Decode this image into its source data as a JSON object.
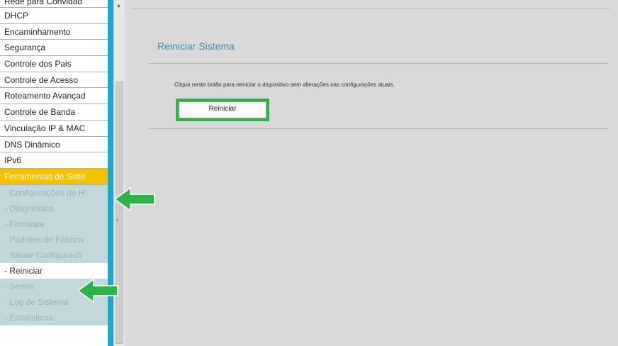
{
  "sidebar": {
    "top_partial": "Rede para Convidad",
    "items": [
      {
        "label": "DHCP"
      },
      {
        "label": "Encaminhamento"
      },
      {
        "label": "Segurança"
      },
      {
        "label": "Controle dos Pais"
      },
      {
        "label": "Controle de Acesso"
      },
      {
        "label": "Roteamento Avançad"
      },
      {
        "label": "Controle de Banda"
      },
      {
        "label": "Vinculação IP & MAC"
      },
      {
        "label": "DNS Dinâmico"
      },
      {
        "label": "IPv6"
      }
    ],
    "active_section": "Ferramentas de Siste",
    "sub_items": [
      {
        "label": "- Configurações de H"
      },
      {
        "label": "- Diagnóstico"
      },
      {
        "label": "- Firmware"
      },
      {
        "label": "- Padrões de Fábrica"
      },
      {
        "label": "- Salvar Configuraçõ"
      },
      {
        "label": "- Reiniciar"
      },
      {
        "label": "- Senha"
      },
      {
        "label": "- Log de Sistema"
      },
      {
        "label": "- Estatísticas"
      }
    ]
  },
  "main": {
    "title": "Reiniciar Sistema",
    "description": "Clique neste botão para reiniciar o dispositivo sem alterações nas configurações atuais.",
    "restart_button": "Reiniciar"
  },
  "colors": {
    "sidebar_border": "#1fa8c9",
    "active_section": "#f2c300",
    "title": "#3a8fb7",
    "highlight": "#2db34a"
  },
  "icons": [
    "scroll-up-icon",
    "arrow-left-icon"
  ]
}
